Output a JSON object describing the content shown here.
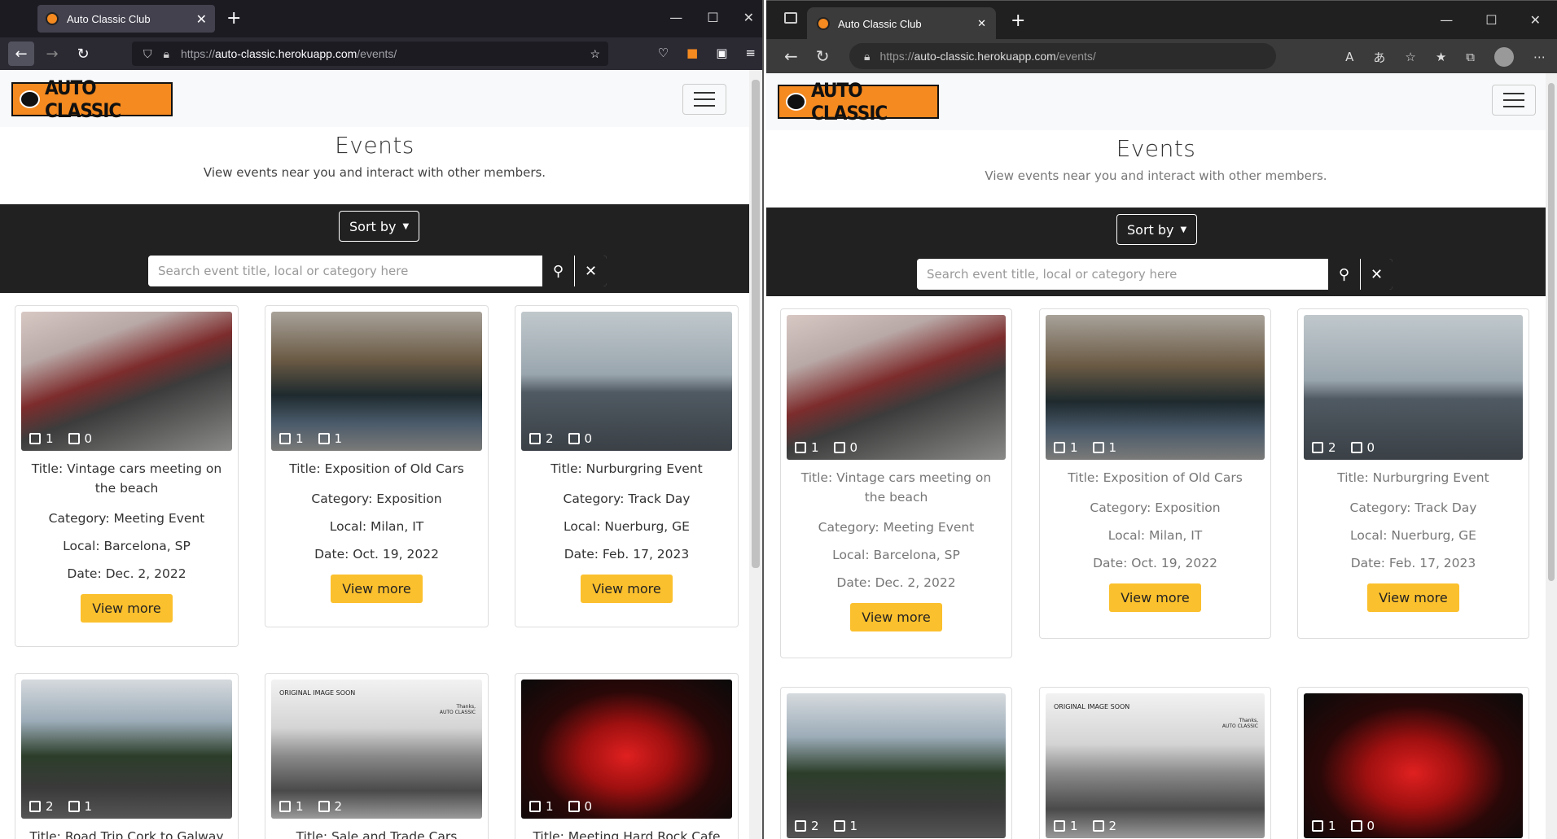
{
  "firefox": {
    "tab_title": "Auto Classic Club",
    "url_prefix": "https://",
    "url_host": "auto-classic.herokuapp.com",
    "url_path": "/events/"
  },
  "edge": {
    "tab_title": "Auto Classic Club",
    "url_prefix": "https://",
    "url_host": "auto-classic.herokuapp.com",
    "url_path": "/events/"
  },
  "site": {
    "logo_text": "AUTO CLASSIC",
    "heading": "Events",
    "subheading": "View events near you and interact with other members.",
    "sort_label": "Sort by",
    "search_placeholder": "Search event title, local or category here",
    "view_more": "View more"
  },
  "events": [
    {
      "title": "Title: Vintage cars meeting on the beach",
      "category": "Category: Meeting Event",
      "local": "Local: Barcelona, SP",
      "date": "Date: Dec. 2, 2022",
      "a": "1",
      "b": "0"
    },
    {
      "title": "Title: Exposition of Old Cars",
      "category": "Category: Exposition",
      "local": "Local: Milan, IT",
      "date": "Date: Oct. 19, 2022",
      "a": "1",
      "b": "1"
    },
    {
      "title": "Title: Nurburgring Event",
      "category": "Category: Track Day",
      "local": "Local: Nuerburg, GE",
      "date": "Date: Feb. 17, 2023",
      "a": "2",
      "b": "0"
    },
    {
      "title": "Title: Road Trip Cork to Galway",
      "a": "2",
      "b": "1",
      "edge_b": "1"
    },
    {
      "title": "Title: Sale and Trade Cars",
      "a": "1",
      "b": "2",
      "note": "ORIGINAL IMAGE SOON",
      "thanks": "Thanks,",
      "brand": "AUTO CLASSIC"
    },
    {
      "title": "Title: Meeting Hard Rock Cafe",
      "a": "1",
      "b": "0"
    }
  ],
  "edge_events_row2": [
    {
      "a": "2",
      "b": "1"
    },
    {
      "a": "1",
      "b": "2"
    },
    {
      "a": "1",
      "b": "0"
    }
  ]
}
